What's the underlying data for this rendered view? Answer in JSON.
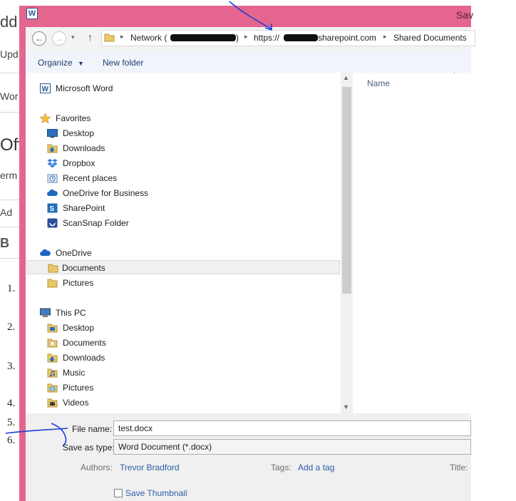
{
  "background_doc": {
    "rows": [
      "dd",
      "Upd",
      "Wor",
      "Off",
      "erm",
      "Ad",
      "B"
    ],
    "numbers": [
      "1.",
      "2.",
      "3.",
      "4.",
      "5.",
      "6."
    ]
  },
  "dialog": {
    "title": "Sav",
    "app_icon_letter": "W"
  },
  "address_bar": {
    "crumbs": [
      "Network (",
      ")",
      "https://",
      "sharepoint.com",
      "Shared Documents"
    ]
  },
  "toolbar": {
    "organize_label": "Organize",
    "new_folder_label": "New folder"
  },
  "nav_tree": {
    "app_item": "Microsoft Word",
    "favorites": {
      "header": "Favorites",
      "items": [
        "Desktop",
        "Downloads",
        "Dropbox",
        "Recent places",
        "OneDrive for Business",
        "SharePoint",
        "ScanSnap Folder"
      ]
    },
    "onedrive": {
      "header": "OneDrive",
      "items": [
        "Documents",
        "Pictures"
      ]
    },
    "this_pc": {
      "header": "This PC",
      "items": [
        "Desktop",
        "Documents",
        "Downloads",
        "Music",
        "Pictures",
        "Videos"
      ]
    }
  },
  "file_list": {
    "column_name": "Name"
  },
  "form": {
    "file_name_label": "File name:",
    "file_name_value": "test.docx",
    "save_as_type_label": "Save as type:",
    "save_as_type_value": "Word Document (*.docx)",
    "authors_label": "Authors:",
    "authors_value": "Trevor Bradford",
    "tags_label": "Tags:",
    "tags_value": "Add a tag",
    "title_label": "Title:",
    "save_thumbnail_label": "Save Thumbnail"
  },
  "colors": {
    "frame": "#e4668e",
    "link": "#2a5fa8",
    "annotation_ink": "#1a3fd8"
  }
}
